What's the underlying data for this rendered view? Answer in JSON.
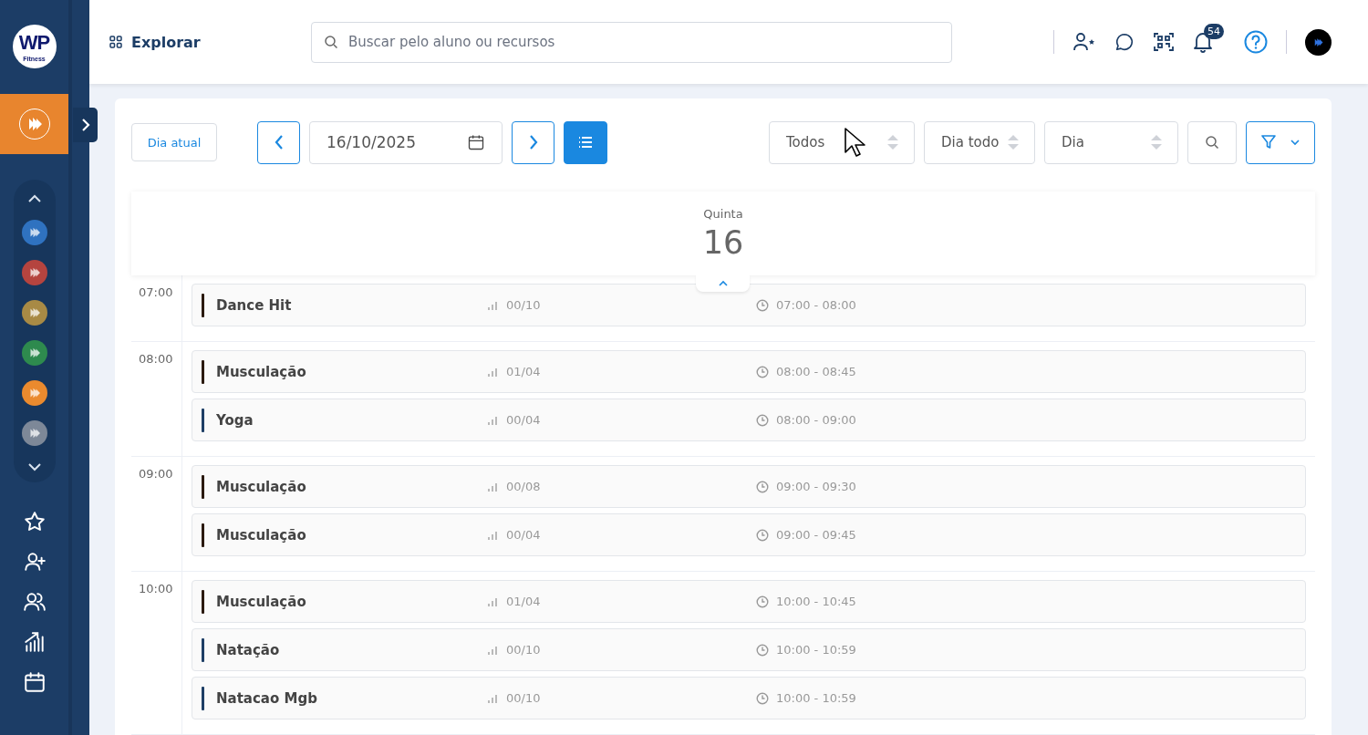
{
  "sidebar": {
    "logo": {
      "title": "WP",
      "subtitle": "Fitness"
    },
    "units": [
      {
        "color": "#2f72c0"
      },
      {
        "color": "#b5443f"
      },
      {
        "color": "#a88a45"
      },
      {
        "color": "#2e8a4e"
      },
      {
        "color": "#ea8a2e"
      },
      {
        "color": "#7d8898"
      }
    ]
  },
  "header": {
    "explore": "Explorar",
    "search": {
      "placeholder": "Buscar pelo aluno ou recursos"
    },
    "notifications_badge": "54"
  },
  "toolbar": {
    "today_button": "Dia atual",
    "date": "16/10/2025",
    "selects": [
      "Todos",
      "Dia todo",
      "Dia"
    ]
  },
  "day": {
    "weekday": "Quinta",
    "number": "16"
  },
  "hours": [
    {
      "time": "07:00",
      "classes": [
        {
          "name": "Dance Hit",
          "count": "00/10",
          "time": "07:00 - 08:00",
          "color": "#2b1a10"
        }
      ]
    },
    {
      "time": "08:00",
      "classes": [
        {
          "name": "Musculação",
          "count": "01/04",
          "time": "08:00 - 08:45",
          "color": "#2b1a10"
        },
        {
          "name": "Yoga",
          "count": "00/04",
          "time": "08:00 - 09:00",
          "color": "#1e3f66"
        }
      ]
    },
    {
      "time": "09:00",
      "classes": [
        {
          "name": "Musculação",
          "count": "00/08",
          "time": "09:00 - 09:30",
          "color": "#2b1a10"
        },
        {
          "name": "Musculação",
          "count": "00/04",
          "time": "09:00 - 09:45",
          "color": "#2b1a10"
        }
      ]
    },
    {
      "time": "10:00",
      "classes": [
        {
          "name": "Musculação",
          "count": "01/04",
          "time": "10:00 - 10:45",
          "color": "#2b1a10"
        },
        {
          "name": "Natação",
          "count": "00/10",
          "time": "10:00 - 10:59",
          "color": "#1e3f66"
        },
        {
          "name": "Natacao Mgb",
          "count": "00/10",
          "time": "10:00 - 10:59",
          "color": "#1e3f66"
        }
      ]
    }
  ]
}
